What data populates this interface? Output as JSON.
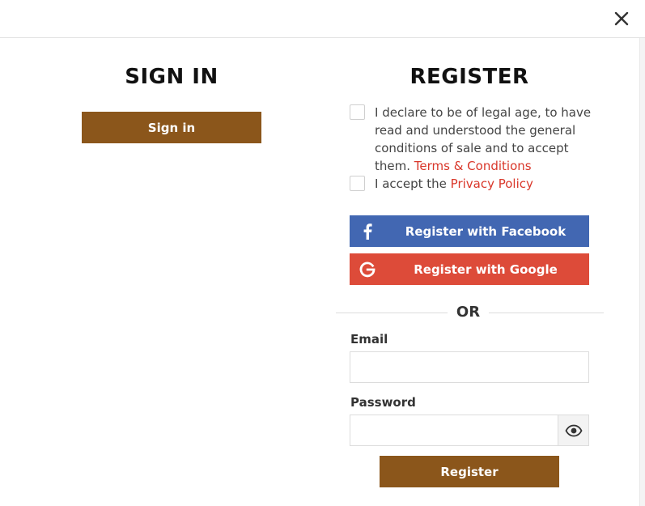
{
  "header": {
    "close_icon": "close-icon"
  },
  "sign_in": {
    "title": "SIGN IN",
    "button_label": "Sign in"
  },
  "register": {
    "title": "REGISTER",
    "legal_consent": {
      "text": "I declare to be of legal age, to have read and understood the general conditions of sale and to accept them. ",
      "link": "Terms & Conditions",
      "checked": false
    },
    "privacy_consent": {
      "text": "I accept the ",
      "link": "Privacy Policy",
      "checked": false
    },
    "facebook_button": {
      "label": "Register with Facebook",
      "icon": "facebook-icon",
      "color": "#4267b2"
    },
    "google_button": {
      "label": "Register with Google",
      "icon": "google-icon",
      "color": "#dd4b39"
    },
    "divider_text": "OR",
    "email": {
      "label": "Email",
      "value": "",
      "placeholder": ""
    },
    "password": {
      "label": "Password",
      "value": "",
      "placeholder": "",
      "toggle_icon": "eye-icon"
    },
    "submit_label": "Register"
  },
  "colors": {
    "brand_brown": "#8b561b",
    "link_red": "#d9372a",
    "facebook_blue": "#4267b2",
    "google_red": "#dd4b39"
  }
}
